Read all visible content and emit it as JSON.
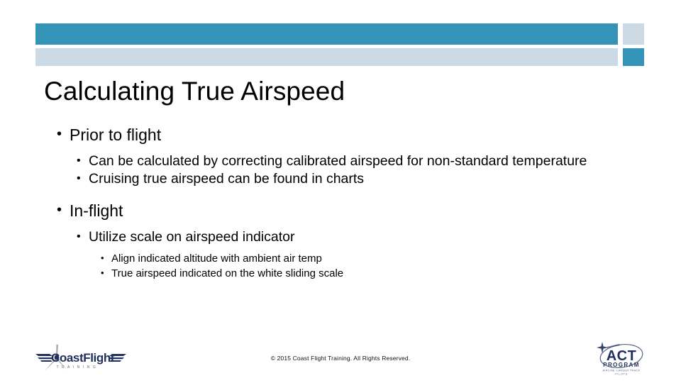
{
  "slide": {
    "title": "Calculating True Airspeed",
    "bullet_glyph": "•"
  },
  "theme": {
    "accent_teal": "#3494b8",
    "accent_light_blue": "#ccdae5",
    "logo_navy": "#20305c",
    "logo_gray": "#8c8c8c",
    "text_color": "#000000",
    "background": "#ffffff"
  },
  "body": {
    "sections": [
      {
        "heading": "Prior to flight",
        "points": [
          "Can be calculated by correcting calibrated airspeed for non-standard temperature",
          "Cruising true airspeed can be found in charts"
        ]
      },
      {
        "heading": "In-flight",
        "points": [
          "Utilize scale on airspeed indicator"
        ],
        "subpoints": [
          "Align indicated altitude with ambient air temp",
          "True airspeed indicated on the white sliding scale"
        ]
      }
    ]
  },
  "footer": {
    "copyright": "© 2015 Coast Flight Training. All Rights Reserved.",
    "left_logo": {
      "name": "coastflight-logo",
      "text_coast": "C",
      "text_oast": "oast",
      "text_flight": "Flight",
      "tagline": "T R A I N I N G"
    },
    "right_logo": {
      "name": "act-program-logo",
      "text_act": "ACT",
      "text_program": "PROGRAM",
      "text_sub1": "AIRLINE CAREER TRACK",
      "text_sub2": "PILOTS"
    }
  }
}
